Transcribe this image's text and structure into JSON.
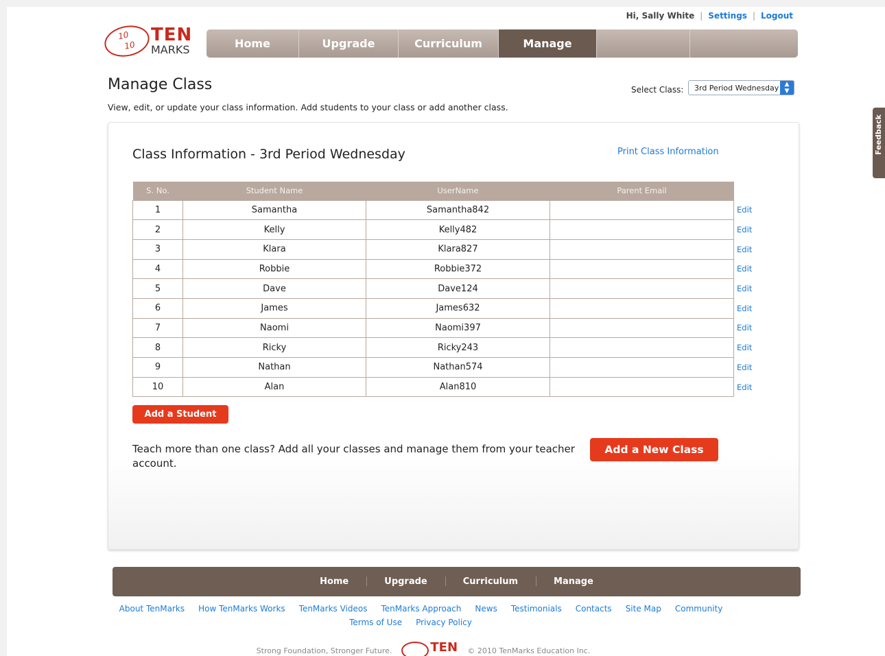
{
  "user": {
    "greeting": "Hi, Sally White",
    "settings": "Settings",
    "logout": "Logout",
    "separator": "|"
  },
  "logo": {
    "ten": "TEN",
    "marks": "MARKS",
    "fraction_top": "10",
    "fraction_bottom": "10"
  },
  "nav": {
    "items": [
      "Home",
      "Upgrade",
      "Curriculum",
      "Manage"
    ],
    "active": "Manage"
  },
  "page": {
    "title": "Manage Class",
    "subtitle": "View, edit, or update your class information. Add students to your class or add another class.",
    "select_label": "Select Class:",
    "select_value": "3rd Period Wednesday"
  },
  "class_info": {
    "heading": "Class Information - 3rd Period Wednesday",
    "print_link": "Print Class Information",
    "columns": [
      "S. No.",
      "Student Name",
      "UserName",
      "Parent Email"
    ],
    "edit_label": "Edit",
    "rows": [
      {
        "no": "1",
        "name": "Samantha",
        "username": "Samantha842",
        "email": ""
      },
      {
        "no": "2",
        "name": "Kelly",
        "username": "Kelly482",
        "email": ""
      },
      {
        "no": "3",
        "name": "Klara",
        "username": "Klara827",
        "email": ""
      },
      {
        "no": "4",
        "name": "Robbie",
        "username": "Robbie372",
        "email": ""
      },
      {
        "no": "5",
        "name": "Dave",
        "username": "Dave124",
        "email": ""
      },
      {
        "no": "6",
        "name": "James",
        "username": "James632",
        "email": ""
      },
      {
        "no": "7",
        "name": "Naomi",
        "username": "Naomi397",
        "email": ""
      },
      {
        "no": "8",
        "name": "Ricky",
        "username": "Ricky243",
        "email": ""
      },
      {
        "no": "9",
        "name": "Nathan",
        "username": "Nathan574",
        "email": ""
      },
      {
        "no": "10",
        "name": "Alan",
        "username": "Alan810",
        "email": ""
      }
    ],
    "add_student": "Add a Student",
    "teach_text": "Teach more than one class? Add all your classes and manage them from your teacher account.",
    "add_class": "Add a New Class"
  },
  "footer": {
    "nav": [
      "Home",
      "Upgrade",
      "Curriculum",
      "Manage"
    ],
    "links_row1": [
      "About TenMarks",
      "How TenMarks Works",
      "TenMarks Videos",
      "TenMarks Approach",
      "News",
      "Testimonials",
      "Contacts",
      "Site Map",
      "Community"
    ],
    "links_row2": [
      "Terms of Use",
      "Privacy Policy"
    ],
    "tagline": "Strong Foundation, Stronger Future.",
    "copyright": "© 2010 TenMarks Education Inc.",
    "logo_text": "TEN"
  },
  "feedback_tab": "Feedback",
  "colors": {
    "accent_red": "#e63a1d",
    "nav_brown": "#6b5a50",
    "link_blue": "#1c7bd6",
    "table_header": "#b8a89e"
  }
}
